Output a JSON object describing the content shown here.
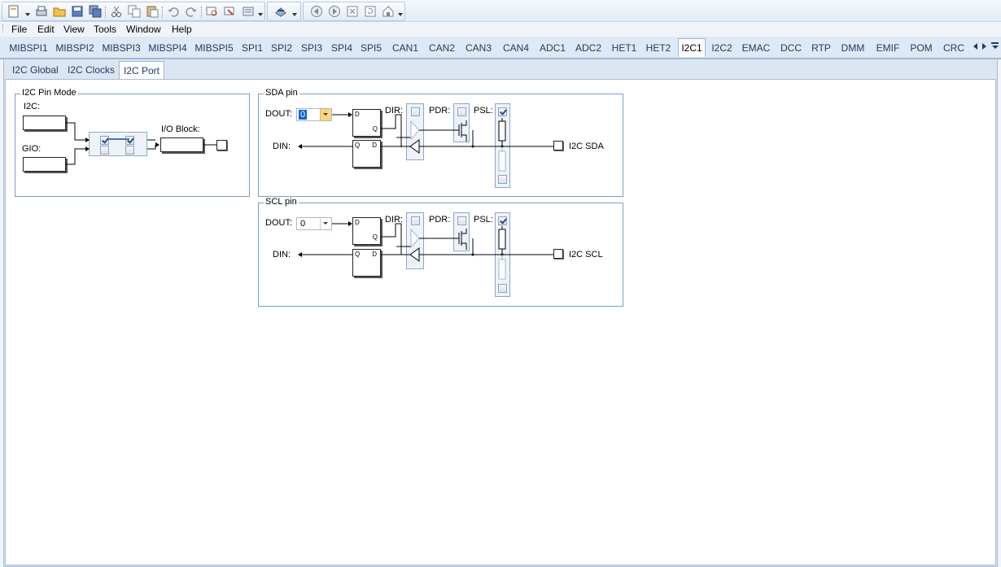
{
  "toolbar": {
    "icons": [
      "new-icon",
      "new-dropdown",
      "print-icon",
      "open-folder-icon",
      "save-icon",
      "save-all-icon",
      "cut-icon",
      "copy-icon",
      "paste-icon",
      "undo-icon",
      "redo-icon",
      "find-icon",
      "replace-icon",
      "properties-icon",
      "generate-code-icon",
      "nav-back-icon",
      "nav-forward-icon",
      "close-doc-icon",
      "refresh-icon",
      "home-icon"
    ]
  },
  "menu": {
    "items": [
      "File",
      "Edit",
      "View",
      "Tools",
      "Window",
      "Help"
    ]
  },
  "module_tabs": {
    "items": [
      "MIBSPI1",
      "MIBSPI2",
      "MIBSPI3",
      "MIBSPI4",
      "MIBSPI5",
      "SPI1",
      "SPI2",
      "SPI3",
      "SPI4",
      "SPI5",
      "CAN1",
      "CAN2",
      "CAN3",
      "CAN4",
      "ADC1",
      "ADC2",
      "HET1",
      "HET2",
      "I2C1",
      "I2C2",
      "EMAC",
      "DCC",
      "RTP",
      "DMM",
      "EMIF",
      "POM",
      "CRC"
    ],
    "active": "I2C1"
  },
  "sub_tabs": {
    "items": [
      "I2C Global",
      "I2C Clocks",
      "I2C Port"
    ],
    "active": "I2C Port"
  },
  "pin_mode": {
    "title": "I2C Pin Mode",
    "i2c_label": "I2C:",
    "gio_label": "GIO:",
    "io_block_label": "I/O Block:"
  },
  "sda": {
    "title": "SDA pin",
    "dout_label": "DOUT:",
    "dout_value": "0",
    "din_label": "DIN:",
    "dir_label": "DIR:",
    "pdr_label": "PDR:",
    "psl_label": "PSL:",
    "pin_name": "I2C SDA",
    "ff_d": "D",
    "ff_q": "Q"
  },
  "scl": {
    "title": "SCL pin",
    "dout_label": "DOUT:",
    "dout_value": "0",
    "din_label": "DIN:",
    "dir_label": "DIR:",
    "pdr_label": "PDR:",
    "psl_label": "PSL:",
    "pin_name": "I2C SCL",
    "ff_d": "D",
    "ff_q": "Q"
  },
  "colors": {
    "accent": "#0a64d6",
    "group_border": "#7d9cc4",
    "highlight": "#fbd77c"
  }
}
